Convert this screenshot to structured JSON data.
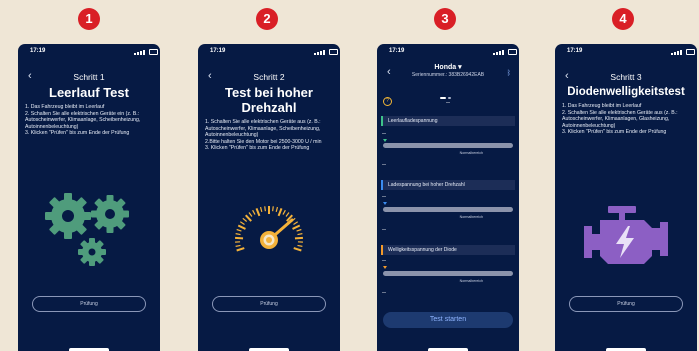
{
  "badges": [
    "1",
    "2",
    "3",
    "4"
  ],
  "status_time": "17:19",
  "phone1": {
    "step": "Schritt 1",
    "title": "Leerlauf Test",
    "instructions": "1. Das Fahrzeug bleibt im Leerlauf\n2. Schalten Sie alle elektrischen Geräte ein (z. B.: Autoscheinwerfer, Klimaanlage, Scheibenheizung, Autoinnenbeleuchtung)\n3. Klicken \"Prüfen\" bis zum Ende der Prüfung",
    "button": "Prüfung",
    "icon": "gears-icon",
    "icon_color": "#4f9c7c"
  },
  "phone2": {
    "step": "Schritt 2",
    "title": "Test bei hoher Drehzahl",
    "instructions": "1. Schalten Sie alle elektrischen Geräte aus (z. B.: Autoscheinwerfer, Klimaanlage, Scheibenheizung, Autoinnenbeleuchtung)\n2.Bitte halten Sie den Motor bei 2500-3000 U / min\n3. Klicken \"Prüfen\" bis zum Ende der Prüfung",
    "button": "Prüfung",
    "icon": "tachometer-icon",
    "icon_color": "#f4b23a"
  },
  "phone3": {
    "brand": "Honda ▾",
    "serial": "Seriennummer.: 383B26942EAB",
    "top_value": "--",
    "sections": [
      {
        "label": "Leerlaufladespannung",
        "color": "#3ec28a",
        "value_top": "--",
        "value_bottom": "--",
        "norm": "Normalbereich"
      },
      {
        "label": "Ladespannung bei hoher Drehzahl",
        "color": "#3b8cf0",
        "value_top": "--",
        "value_bottom": "--",
        "norm": "Normalbereich"
      },
      {
        "label": "Welligkeitsspannung der Diode",
        "color": "#f39a2b",
        "value_top": "--",
        "value_bottom": "--",
        "norm": "Normalbereich"
      }
    ],
    "start": "Test starten"
  },
  "phone4": {
    "step": "Schritt 3",
    "title": "Diodenwelligkeitstest",
    "instructions": "1. Das Fahrzeug bleibt im Leerlauf\n2. Schalten Sie alle elektrischen Geräte aus (z. B.: Autoscheinwerfer, Klimaanlagen, Glasheizung, Autoinnenbeleuchtung)\n3. Klicken \"Prüfen\" bis zum Ende der Prüfung",
    "button": "Prüfung",
    "icon": "engine-lightning-icon",
    "icon_color": "#8c5fc4"
  }
}
